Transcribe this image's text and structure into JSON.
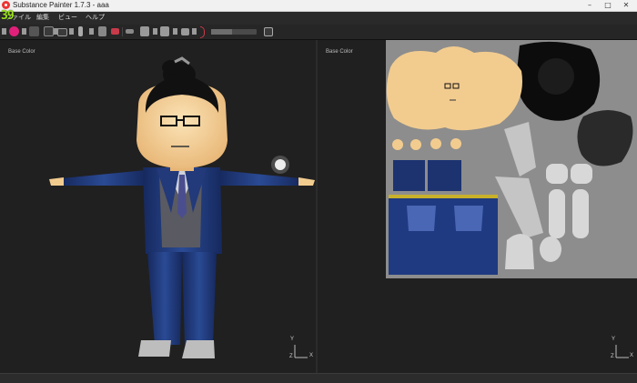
{
  "window": {
    "title": "Substance Painter 1.7.3 - aaa",
    "controls": [
      "–",
      "□",
      "✕"
    ]
  },
  "fps": "39",
  "menu": [
    {
      "label": "ファイル"
    },
    {
      "label": "編集"
    },
    {
      "label": "ビュー"
    },
    {
      "label": "ヘルプ"
    }
  ],
  "toolbar": {
    "tools": [
      "refresh-icon",
      "paint-brush-icon",
      "pencil-icon",
      "eraser-icon",
      "projection-icon",
      "eyedropper-icon",
      "fill-icon",
      "symmetry-icon",
      "mirror-icon",
      "grid-icon",
      "camera-icon",
      "reset-icon",
      "color-picker-icon"
    ],
    "slider_level": 0.45,
    "accent_color": "#e0207a"
  },
  "viewports": {
    "left": {
      "label": "Base Color",
      "axes": [
        "Y",
        "X",
        "Z"
      ]
    },
    "right": {
      "label": "Base Color",
      "axes": [
        "Y",
        "X",
        "Z"
      ]
    }
  },
  "colors": {
    "suit": "#1c3370",
    "skin": "#f2cc8f",
    "hair": "#111111",
    "background": "#202020"
  }
}
